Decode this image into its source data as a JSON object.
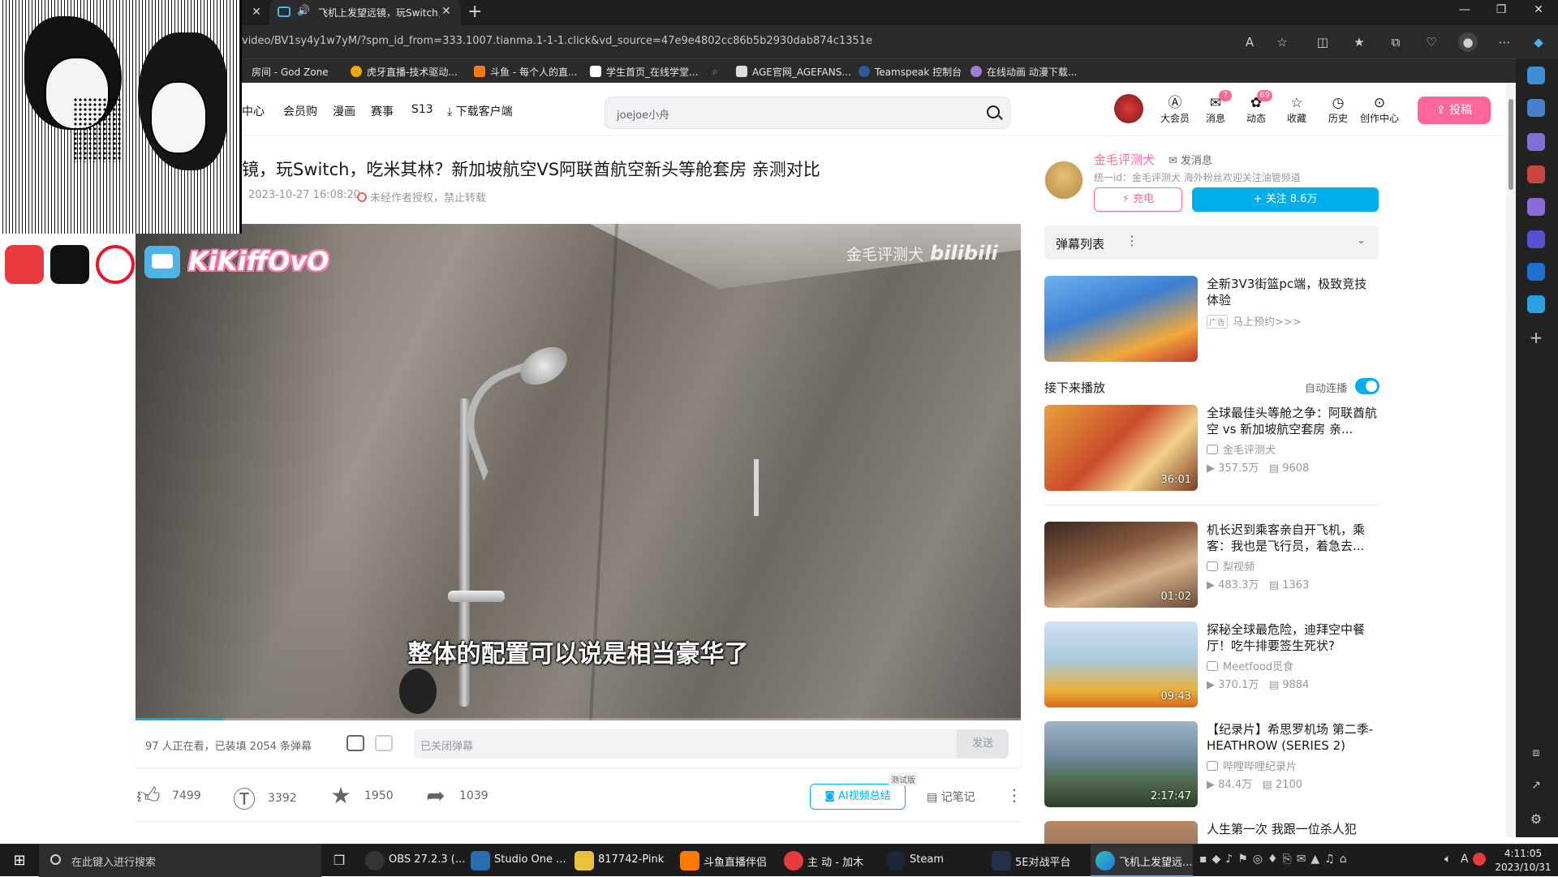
{
  "browser": {
    "tab_title": "飞机上发望远镜，玩Switch，",
    "url": "video/BV1sy4y1w7yM/?spm_id_from=333.1007.tianma.1-1-1.click&vd_source=47e9e4802cc86b5b2930dab874c1351e",
    "bookmarks": [
      "房间 - God Zone",
      "虎牙直播-技术驱动...",
      "斗鱼 - 每个人的直...",
      "学生首页_在线学堂...",
      "",
      "AGE官网_AGEFANS...",
      "Teamspeak 控制台",
      "在线动画 动漫下载..."
    ],
    "window_controls": [
      "—",
      "❐",
      "✕"
    ]
  },
  "header": {
    "nav_items": [
      "中心",
      "会员购",
      "漫画",
      "赛事",
      "S13",
      "下载客户端"
    ],
    "search_placeholder": "joejoe小舟",
    "icons": [
      {
        "label": "大会员",
        "glyph": "Ⓐ",
        "badge": ""
      },
      {
        "label": "消息",
        "glyph": "✉",
        "badge": "7"
      },
      {
        "label": "动态",
        "glyph": "✿",
        "badge": "69"
      },
      {
        "label": "收藏",
        "glyph": "☆",
        "badge": ""
      },
      {
        "label": "历史",
        "glyph": "◷",
        "badge": ""
      },
      {
        "label": "创作中心",
        "glyph": "⊙",
        "badge": ""
      }
    ],
    "upload_label": "投稿"
  },
  "video": {
    "title": "镜，玩Switch，吃米其林？新加坡航空VS阿联酋航空新头等舱套房 亲测对比",
    "date": "2023-10-27 16:08:20",
    "notice": "未经作者授权，禁止转载",
    "watermark": "金毛评测犬",
    "watermark_logo": "bilibili",
    "subtitle": "整体的配置可以说是相当豪华了",
    "progress": 0.1
  },
  "danmaku": {
    "info": "97 人正在看，已装填 2054 条弹幕",
    "placeholder": "已关闭弹幕",
    "send": "发送"
  },
  "actions": {
    "like": "7499",
    "coin": "3392",
    "fav": "1950",
    "share": "1039",
    "ai_summary": "AI视频总结",
    "beta": "测试版",
    "note": "记笔记"
  },
  "uploader": {
    "name": "金毛评测犬",
    "message": "发消息",
    "desc": "统一id：金毛评测犬 海外粉丝欢迎关注油管频道",
    "charge": "充电",
    "follow": "关注 8.6万"
  },
  "danmaku_list": {
    "label": "弹幕列表"
  },
  "ad": {
    "title": "全新3V3街篮pc端，极致竞技体验",
    "tag": "广告",
    "cta": "马上预约>>>"
  },
  "next": {
    "label": "接下来播放",
    "autoplay": "自动连播"
  },
  "recommendations": [
    {
      "title": "全球最佳头等舱之争：阿联酋航空 vs 新加坡航空套房 亲...",
      "author": "金毛评测犬",
      "views": "357.5万",
      "danmaku": "9608",
      "duration": "36:01"
    },
    {
      "title": "机长迟到乘客亲自开飞机，乘客：我也是飞行员，着急去...",
      "author": "梨视频",
      "views": "483.3万",
      "danmaku": "1363",
      "duration": "01:02"
    },
    {
      "title": "探秘全球最危险，迪拜空中餐厅！吃牛排要签生死状?",
      "author": "Meetfood觅食",
      "views": "370.1万",
      "danmaku": "9884",
      "duration": "09:43"
    },
    {
      "title": "【纪录片】希思罗机场 第二季-HEATHROW (SERIES 2)",
      "author": "哔哩哔哩纪录片",
      "views": "84.4万",
      "danmaku": "2100",
      "duration": "2:17:47"
    },
    {
      "title": "人生第一次 我跟一位杀人犯",
      "author": "",
      "views": "",
      "danmaku": "",
      "duration": ""
    }
  ],
  "overlay": {
    "streamer": "KiKiffOvO"
  },
  "taskbar": {
    "search_placeholder": "在此键入进行搜索",
    "apps": [
      "OBS 27.2.3 (...",
      "Studio One ...",
      "817742-Pink",
      "斗鱼直播伴侣",
      "主 动 - 加木",
      "Steam",
      "5E对战平台",
      "飞机上发望远..."
    ],
    "time": "4:11:05",
    "date": "2023/10/31"
  },
  "colors": {
    "accent": "#00aeec",
    "pink": "#ff6699",
    "link_pink": "#fb7299"
  }
}
